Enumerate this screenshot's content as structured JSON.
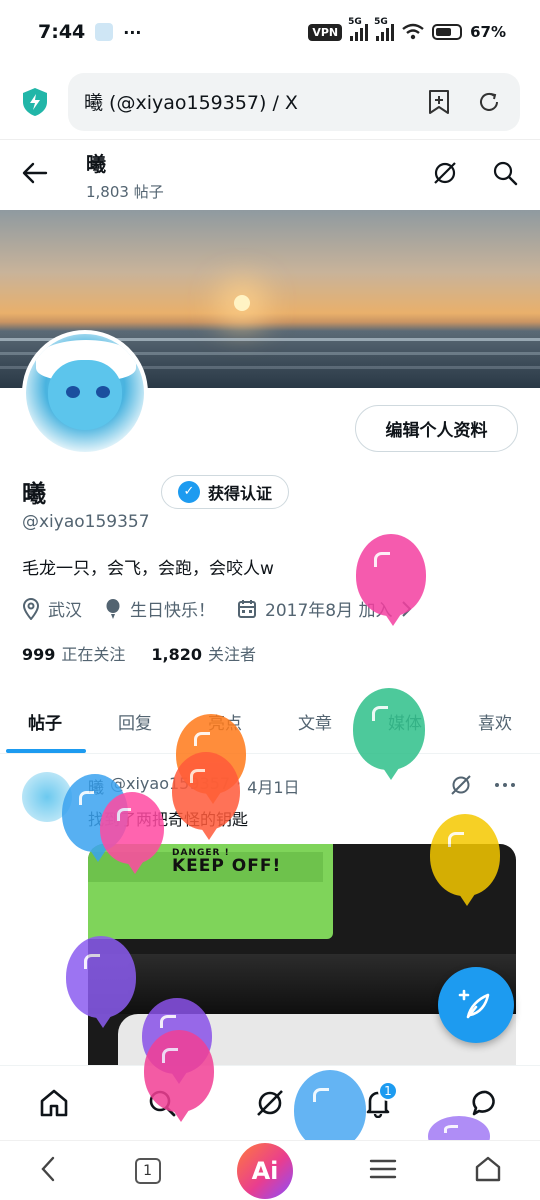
{
  "status_bar": {
    "time": "7:44",
    "more": "···",
    "vpn": "VPN",
    "net1": "5G",
    "net2": "5G",
    "battery": "67%",
    "battery_level": 0.67
  },
  "browser": {
    "url_title": "曦 (@xiyao159357) / X"
  },
  "header": {
    "name": "曦",
    "post_count": "1,803 帖子"
  },
  "profile": {
    "edit_label": "编辑个人资料",
    "name": "曦",
    "verify_label": "获得认证",
    "handle": "@xiyao159357",
    "bio": "毛龙一只，会飞，会跑，会咬人w",
    "location": "武汉",
    "birthday": "生日快乐！",
    "joined": "2017年8月 加入",
    "following_count": "999",
    "following_label": "正在关注",
    "followers_count": "1,820",
    "followers_label": "关注者"
  },
  "tabs": [
    {
      "label": "帖子",
      "active": true
    },
    {
      "label": "回复",
      "active": false
    },
    {
      "label": "亮点",
      "active": false
    },
    {
      "label": "文章",
      "active": false
    },
    {
      "label": "媒体",
      "active": false
    },
    {
      "label": "喜欢",
      "active": false
    }
  ],
  "post": {
    "name": "曦",
    "handle": "@xiyao159357",
    "sep": "·",
    "date": "4月1日",
    "text": "找到了两把奇怪的钥匙",
    "image": {
      "keycap_warning": "DANGER !",
      "keycap_text": "KEEP OFF!"
    }
  },
  "bottom_nav": {
    "notification_badge": "1"
  },
  "system_nav": {
    "tab_count": "1",
    "ai_label": "Ai"
  },
  "colors": {
    "accent": "#1d9bf0",
    "text": "#0f1419",
    "muted": "#536471"
  }
}
